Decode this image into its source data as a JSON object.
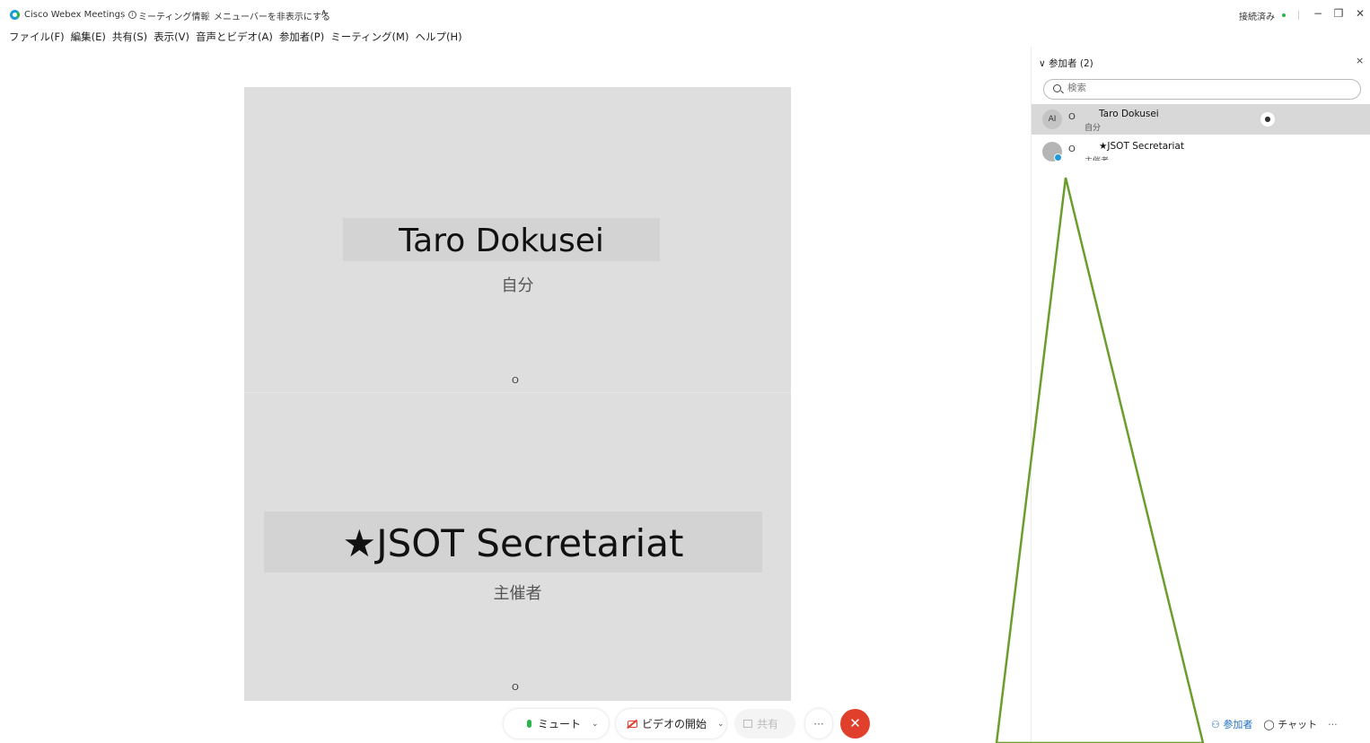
{
  "titlebar": {
    "app_name": "Cisco Webex Meetings",
    "meeting_info": "ミーティング情報",
    "hide_menu": "メニューバーを非表示にする",
    "hide_menu_chevron": "∧",
    "status": "接続済み",
    "minimize": "−",
    "restore": "❐",
    "close": "✕"
  },
  "menubar": {
    "items": [
      "ファイル(F)",
      "編集(E)",
      "共有(S)",
      "表示(V)",
      "音声とビデオ(A)",
      "参加者(P)",
      "ミーティング(M)",
      "ヘルプ(H)"
    ]
  },
  "stage": {
    "tiles": [
      {
        "name": "Taro Dokusei",
        "role": "自分",
        "audio": "Ο"
      },
      {
        "name": "★JSOT Secretariat",
        "role": "主催者",
        "audio": "Ο"
      }
    ]
  },
  "controls": {
    "mute": "ミュート",
    "video": "ビデオの開始",
    "share": "共有",
    "more": "···",
    "end": "✕",
    "chevron": "⌄"
  },
  "panel": {
    "header": "参加者 (2)",
    "header_chevron": "∨",
    "close": "×",
    "search_placeholder": "検索",
    "participants": [
      {
        "avatar": "AI",
        "name": "Taro Dokusei",
        "role": "自分",
        "audio": "Ο",
        "hand": "●"
      },
      {
        "avatar": "",
        "name": "★JSOT Secretariat",
        "role": "主催者",
        "audio": "Ο"
      }
    ],
    "footer": {
      "participants": "参加者",
      "chat": "チャット",
      "more": "···"
    }
  },
  "colors": {
    "accent": "#1f9ad6",
    "connected": "#2db34a",
    "end_call": "#e0402b",
    "annotation": "#6a9e2a"
  }
}
